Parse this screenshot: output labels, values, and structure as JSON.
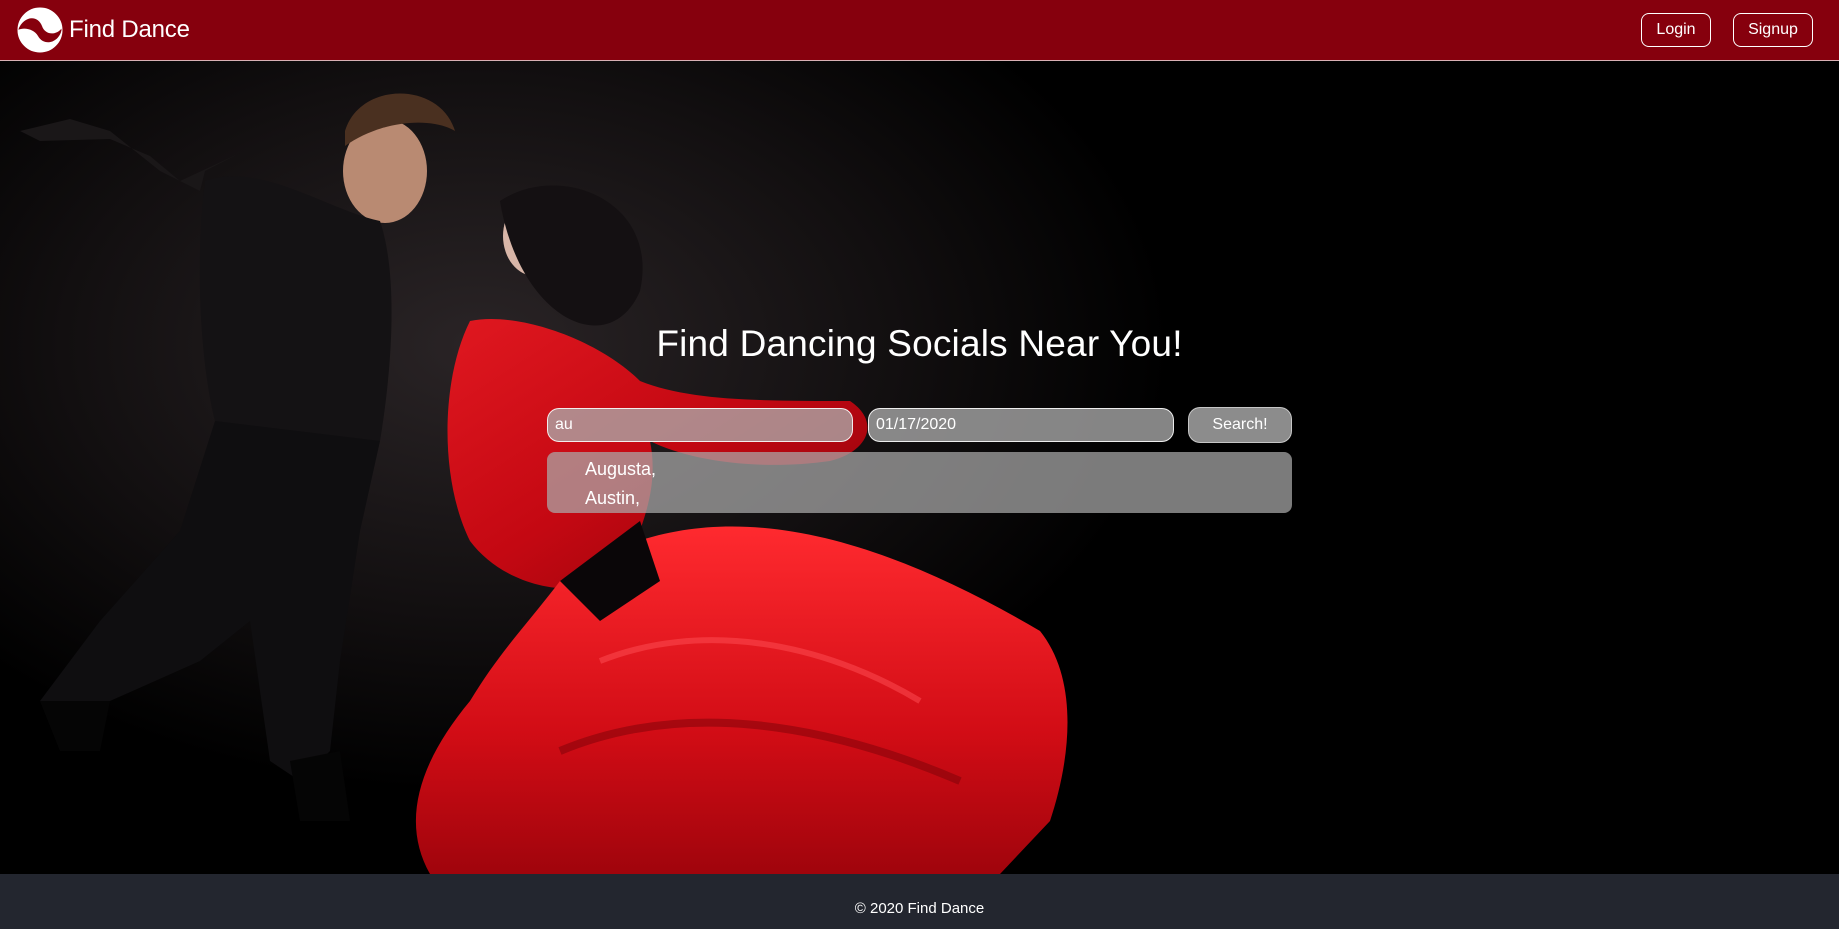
{
  "header": {
    "brand_name": "Find Dance",
    "login_label": "Login",
    "signup_label": "Signup"
  },
  "hero": {
    "title": "Find Dancing Socials Near You!",
    "search": {
      "location_value": "au",
      "date_value": "01/17/2020",
      "button_label": "Search!"
    },
    "suggestions": [
      "Augusta,",
      "Austin,"
    ]
  },
  "footer": {
    "copyright": "© 2020 Find Dance"
  },
  "colors": {
    "navbar": "#86000d",
    "footer": "#23262f",
    "dress": "#d0101a"
  },
  "icons": {
    "logo": "swirl-logo-icon"
  }
}
